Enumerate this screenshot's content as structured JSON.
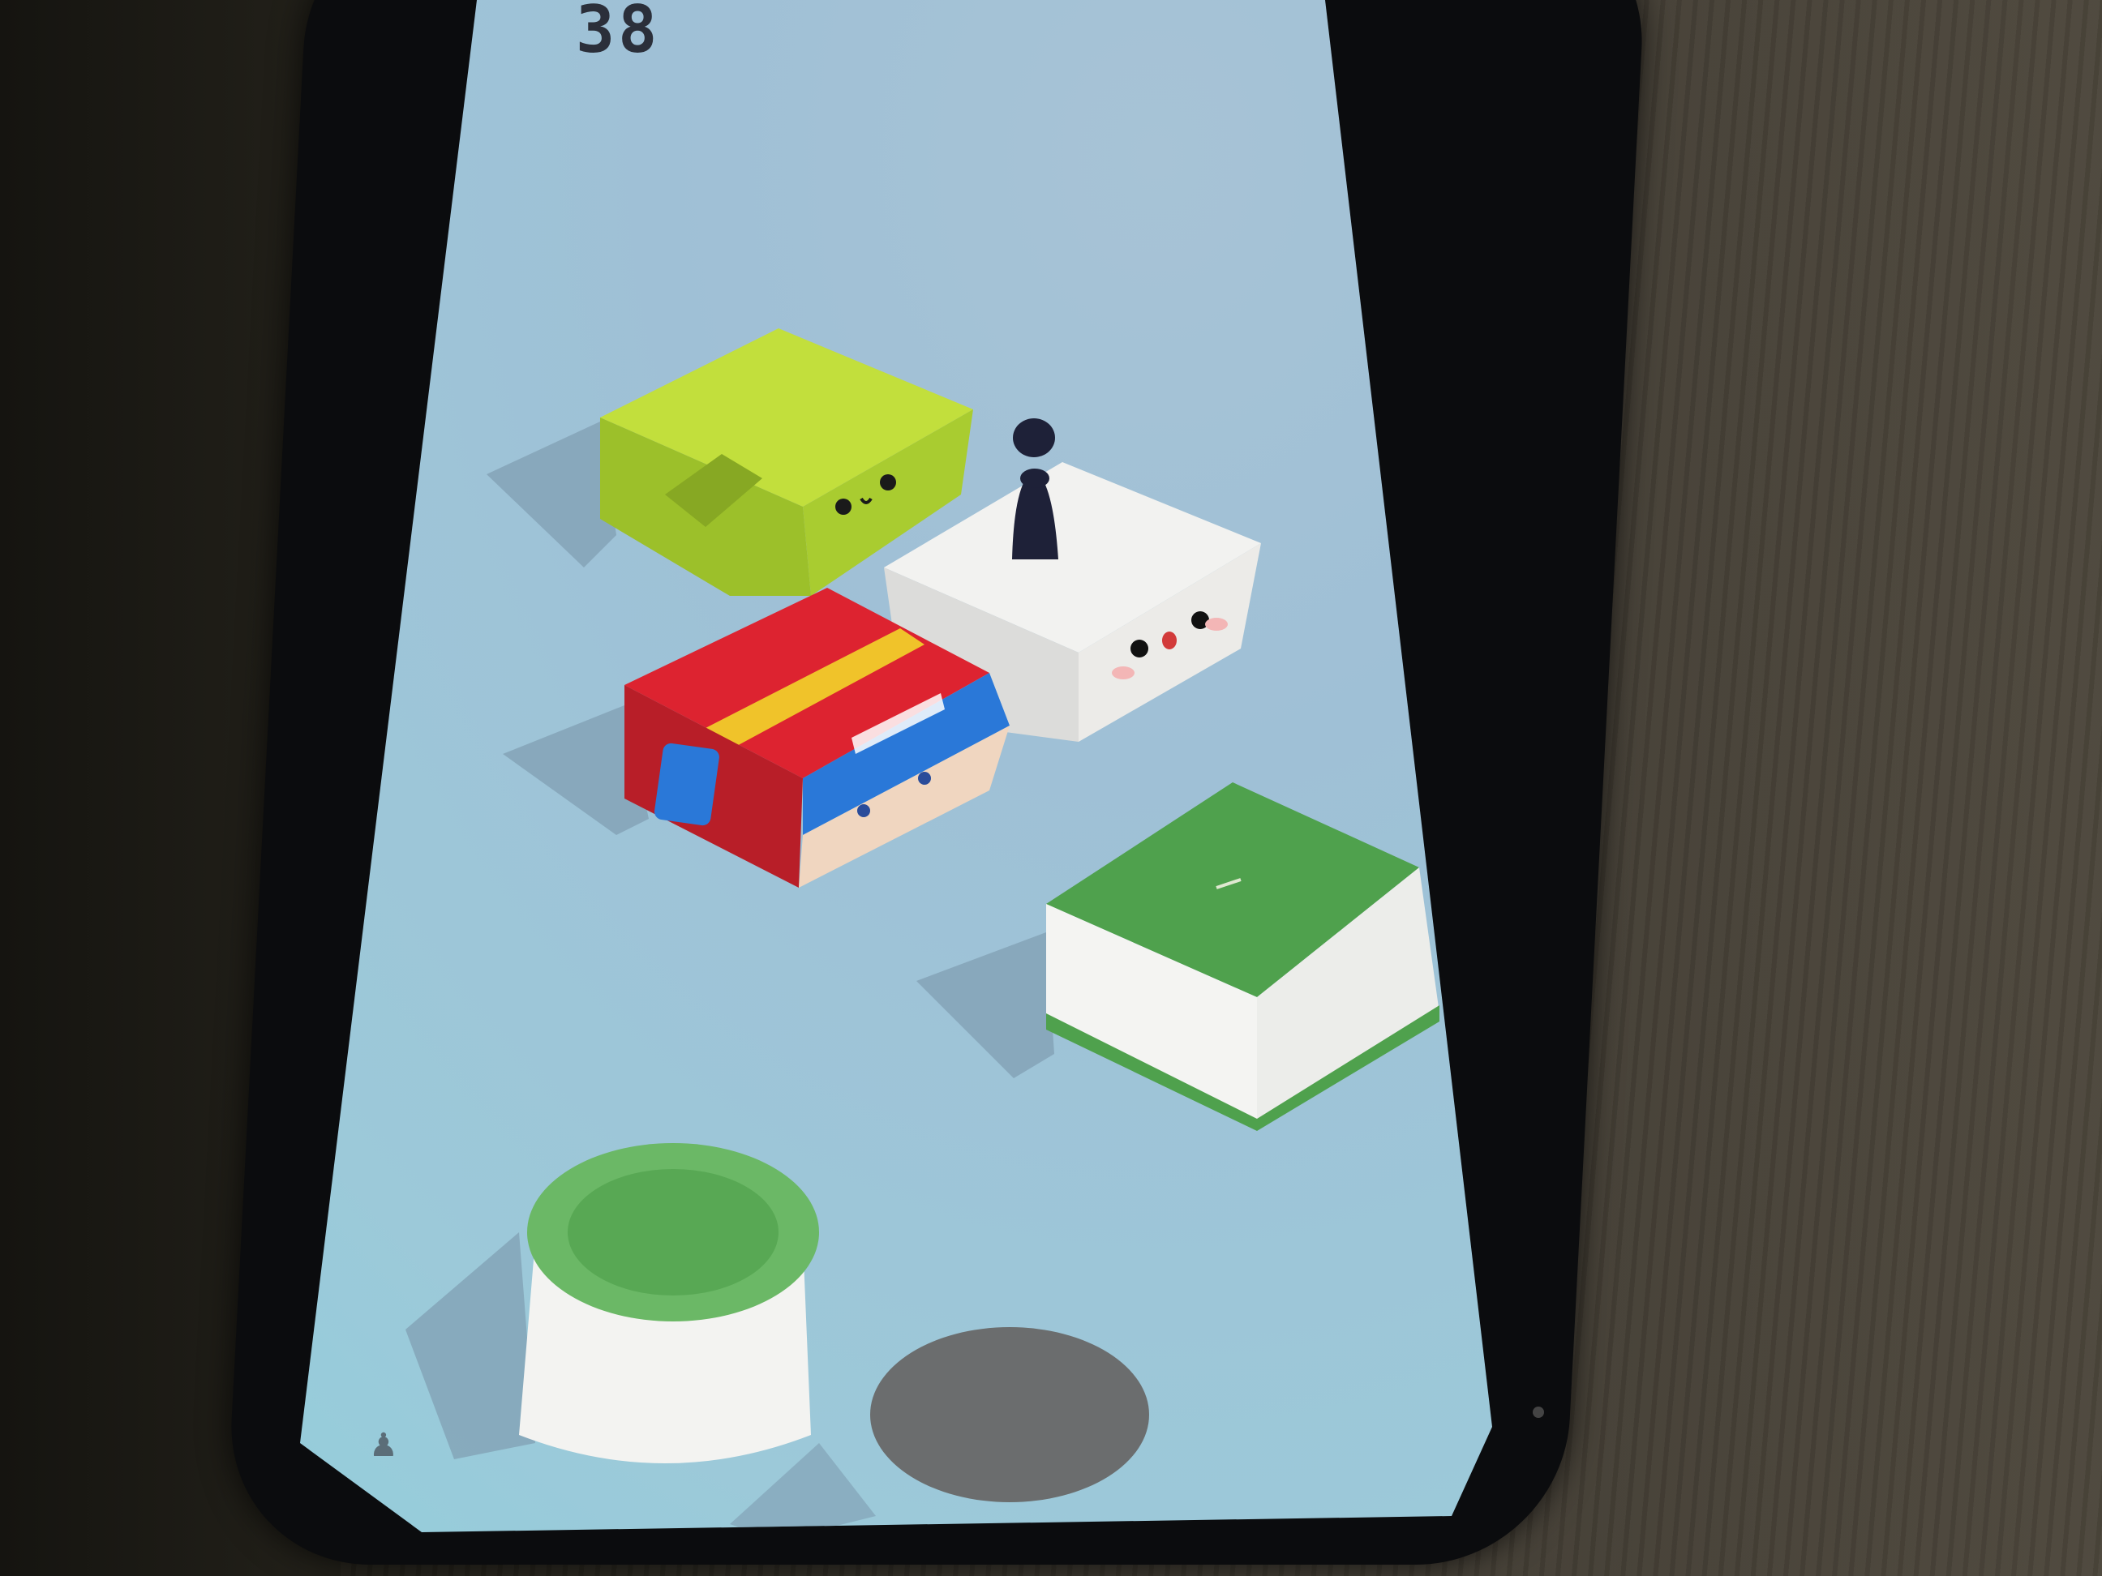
{
  "game": {
    "score": "38",
    "menu_icon": "pawn-icon"
  },
  "colors": {
    "screen_bg": "#9fc4d8",
    "lime_block": "#b4d632",
    "white_block": "#f2f2f0",
    "red_block": "#d9222c",
    "green_block": "#4fa14d",
    "drum_top": "#5fae5a",
    "gray_disc": "#6b6d6e",
    "player": "#1e2138"
  }
}
